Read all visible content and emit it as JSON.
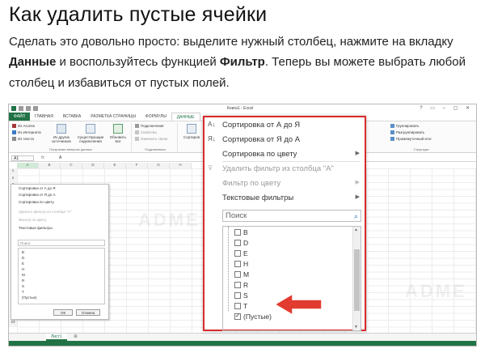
{
  "article": {
    "title": "Как удалить пустые ячейки",
    "para_line1": "Сделать это довольно просто: выделите нужный столбец, нажмите на вкладку",
    "para_line2_bold1": "Данные",
    "para_line2_mid": " и воспользуйтесь функцией ",
    "para_line2_bold2": "Фильтр",
    "para_line2_end": ". Теперь вы можете выбрать любой",
    "para_line3": "столбец и избавиться от пустых полей."
  },
  "excel": {
    "window_title": "Книга1 - Excel",
    "window_controls": "? ▭ – ▢ ✕",
    "tabs": [
      "ФАЙЛ",
      "ГЛАВНАЯ",
      "ВСТАВКА",
      "РАЗМЕТКА СТРАНИЦЫ",
      "ФОРМУЛЫ",
      "ДАННЫЕ"
    ],
    "active_tab": "ДАННЫЕ",
    "ribbon": {
      "left_items": [
        "Из Access",
        "Из Интернета",
        "Из текста"
      ],
      "other_sources": "Из других источников",
      "existing": "Существующие подключения",
      "refresh": "Обновить все",
      "conn_items": [
        "Подключения",
        "Свойства",
        "Изменить связи"
      ],
      "sort": "Сортиров",
      "group_external": "Получение внешних данных",
      "group_connections": "Подключения",
      "outline_items": [
        "Группировать",
        "Разгруппировать",
        "Промежуточный итог"
      ],
      "group_structure": "Структура"
    },
    "namebox": "A1",
    "fx": "fx",
    "formula_value": "A",
    "columns": [
      "A",
      "B",
      "C",
      "D",
      "E",
      "F",
      "G",
      "H"
    ],
    "rows": [
      "1",
      "2",
      "3",
      "4",
      "5",
      "6",
      "7",
      "8",
      "9",
      "10",
      "11",
      "12",
      "13",
      "14",
      "15",
      "16",
      "17",
      "18",
      "19",
      "20",
      "21",
      "22",
      "23"
    ],
    "sheet_tab": "Лист1",
    "sheet_add": "⊕",
    "small_dropdown": {
      "items": [
        "Сортировка от А до Я",
        "Сортировка от Я до А",
        "Сортировка по цвету",
        "Удалить фильтр из столбца \"А\"",
        "Фильтр по цвету",
        "Текстовые фильтры"
      ],
      "search_placeholder": "Поиск",
      "list": [
        "B",
        "D",
        "E",
        "H",
        "M",
        "R",
        "S",
        "T",
        "(Пустые)"
      ],
      "ok": "ОК",
      "cancel": "Отмена"
    },
    "big_dropdown": {
      "sort_az": "Сортировка от А до Я",
      "sort_za": "Сортировка от Я до А",
      "sort_color": "Сортировка по цвету",
      "remove_filter": "Удалить фильтр из столбца \"А\"",
      "filter_color": "Фильтр по цвету",
      "text_filters": "Текстовые фильтры",
      "search_placeholder": "Поиск",
      "list": [
        "B",
        "D",
        "E",
        "H",
        "M",
        "R",
        "S",
        "T",
        "(Пустые)"
      ],
      "checked_item": "(Пустые)"
    },
    "watermark": "ADME",
    "accent_color": "#217346",
    "highlight_color": "#d92b2b"
  }
}
